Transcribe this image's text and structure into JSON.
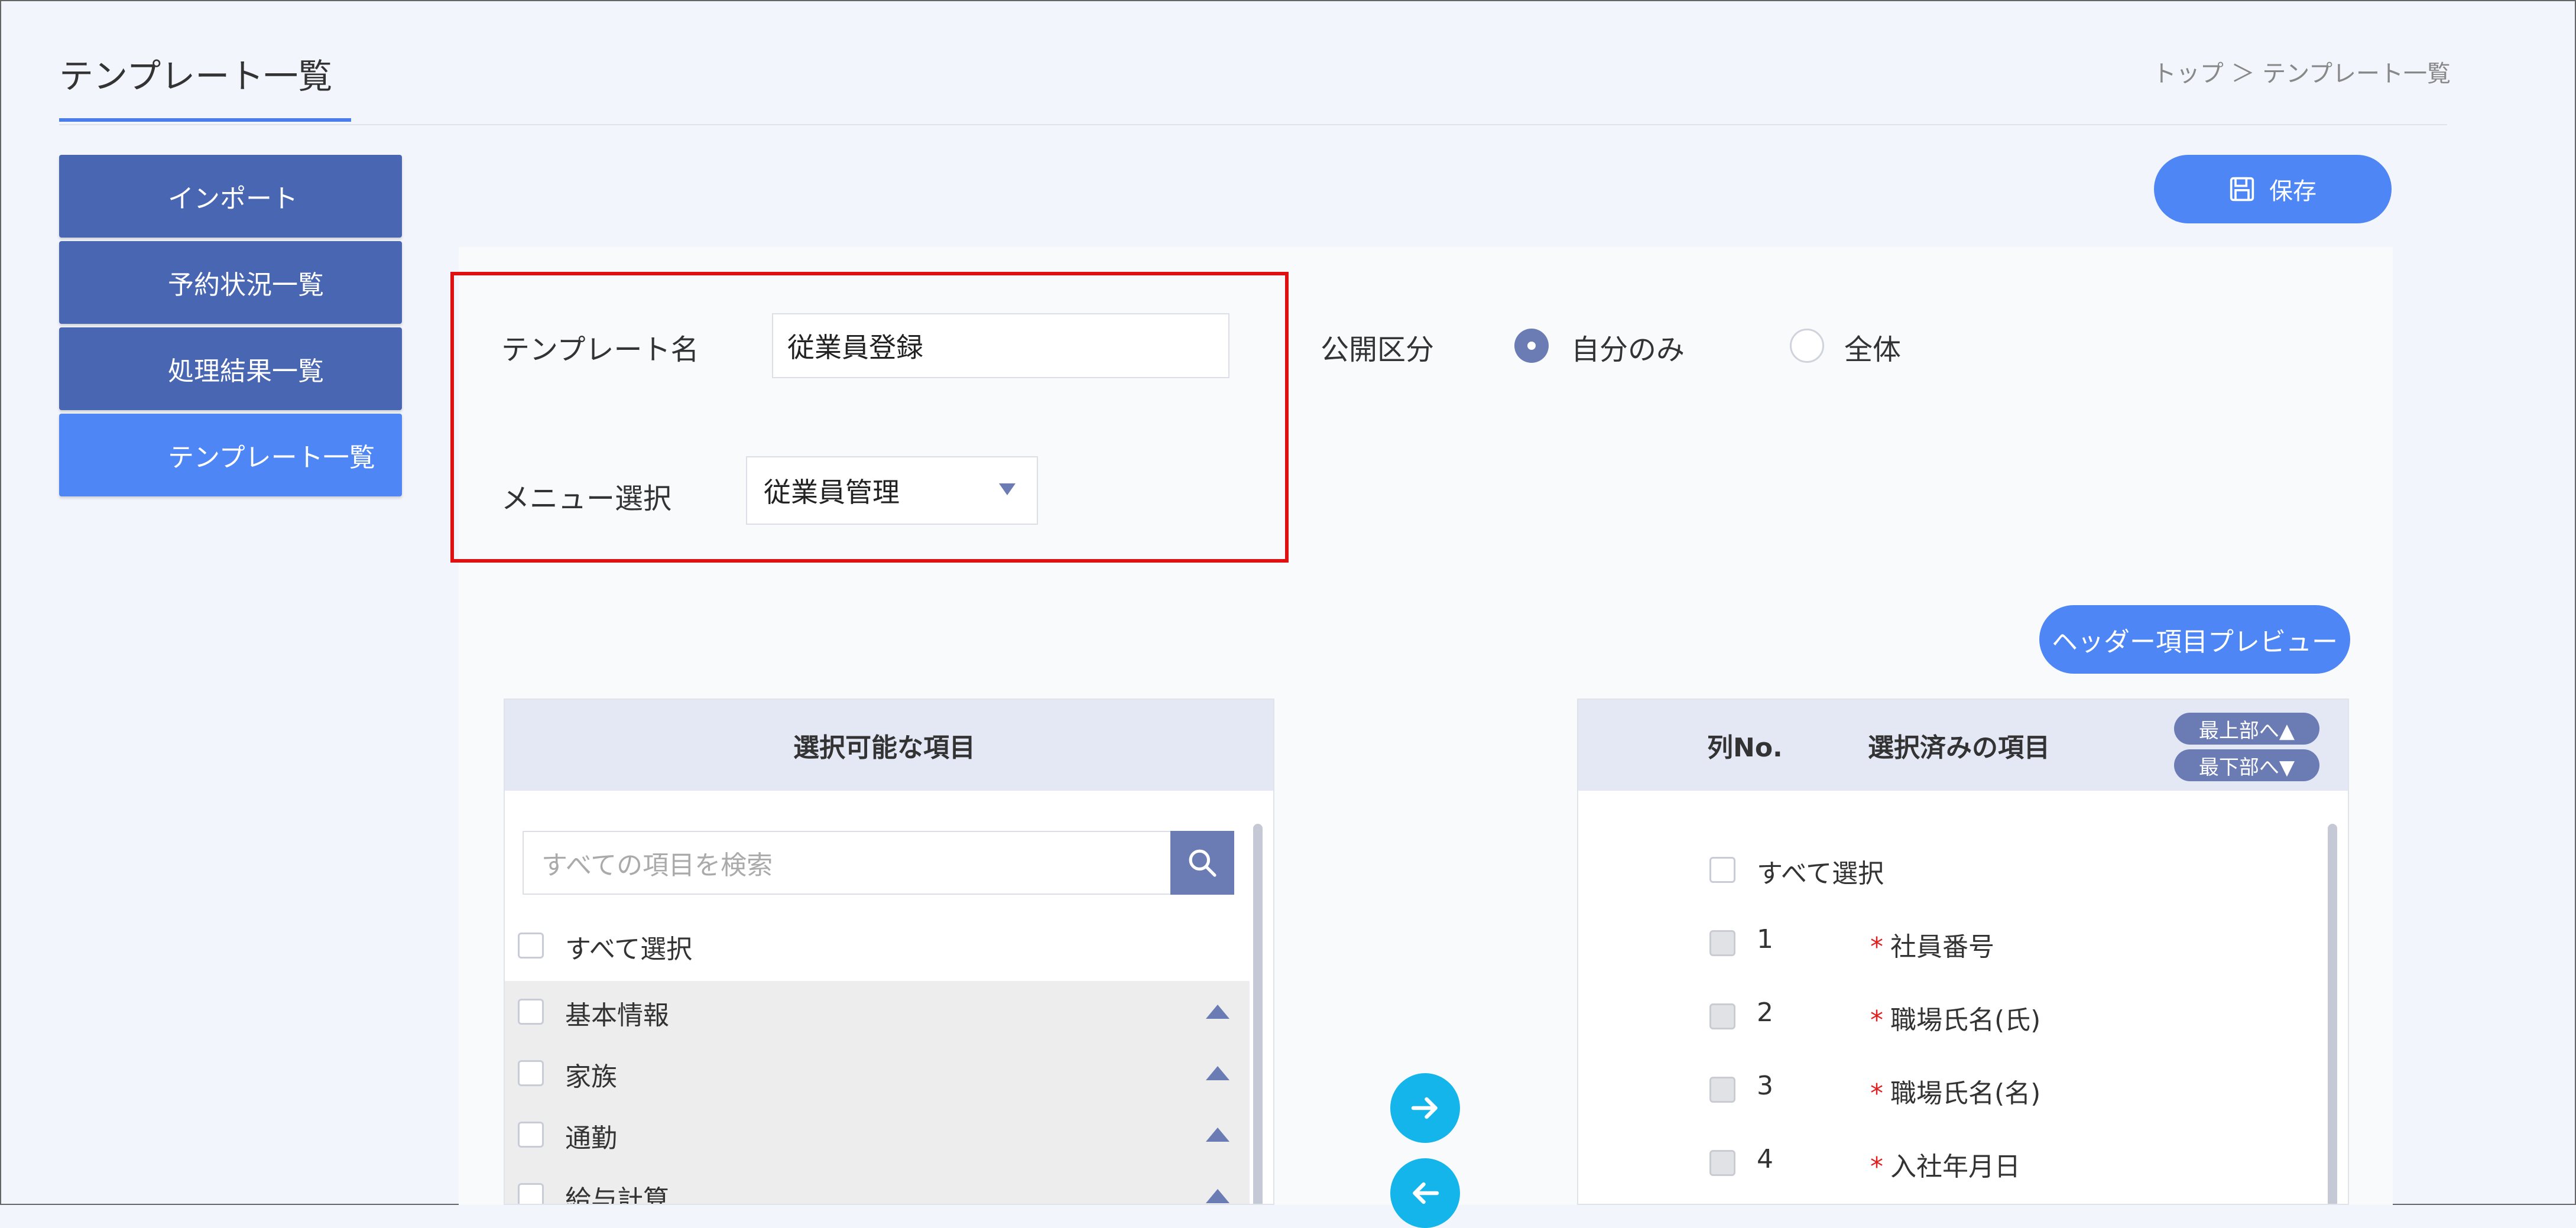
{
  "page": {
    "title": "テンプレート一覧",
    "breadcrumb": "トップ ＞ テンプレート一覧"
  },
  "sidebar": {
    "items": [
      {
        "label": "インポート"
      },
      {
        "label": "予約状況一覧"
      },
      {
        "label": "処理結果一覧"
      },
      {
        "label": "テンプレート一覧"
      }
    ]
  },
  "toolbar": {
    "save_label": "保存",
    "save_icon": "save-icon"
  },
  "form": {
    "template_name_label": "テンプレート名",
    "template_name_value": "従業員登録",
    "menu_label": "メニュー選択",
    "menu_value": "従業員管理",
    "visibility_label": "公開区分",
    "visibility_options": [
      {
        "label": "自分のみ",
        "selected": true
      },
      {
        "label": "全体",
        "selected": false
      }
    ]
  },
  "preview_button_label": "ヘッダー項目プレビュー",
  "available": {
    "header": "選択可能な項目",
    "search_placeholder": "すべての項目を検索",
    "select_all": "すべて選択",
    "categories": [
      {
        "label": "基本情報"
      },
      {
        "label": "家族"
      },
      {
        "label": "通勤"
      },
      {
        "label": "給与計算"
      }
    ]
  },
  "selected": {
    "col_header": "列No.",
    "items_header": "選択済みの項目",
    "move_top": "最上部へ▲",
    "move_bottom": "最下部へ▼",
    "select_all": "すべて選択",
    "rows": [
      {
        "no": "1",
        "required": "*",
        "label": "社員番号"
      },
      {
        "no": "2",
        "required": "*",
        "label": "職場氏名(氏)"
      },
      {
        "no": "3",
        "required": "*",
        "label": "職場氏名(名)"
      },
      {
        "no": "4",
        "required": "*",
        "label": "入社年月日"
      }
    ]
  },
  "colors": {
    "accent": "#4f86f6",
    "sidebar": "#4966b3",
    "highlight": "#e01010",
    "transfer": "#13b5ea"
  }
}
